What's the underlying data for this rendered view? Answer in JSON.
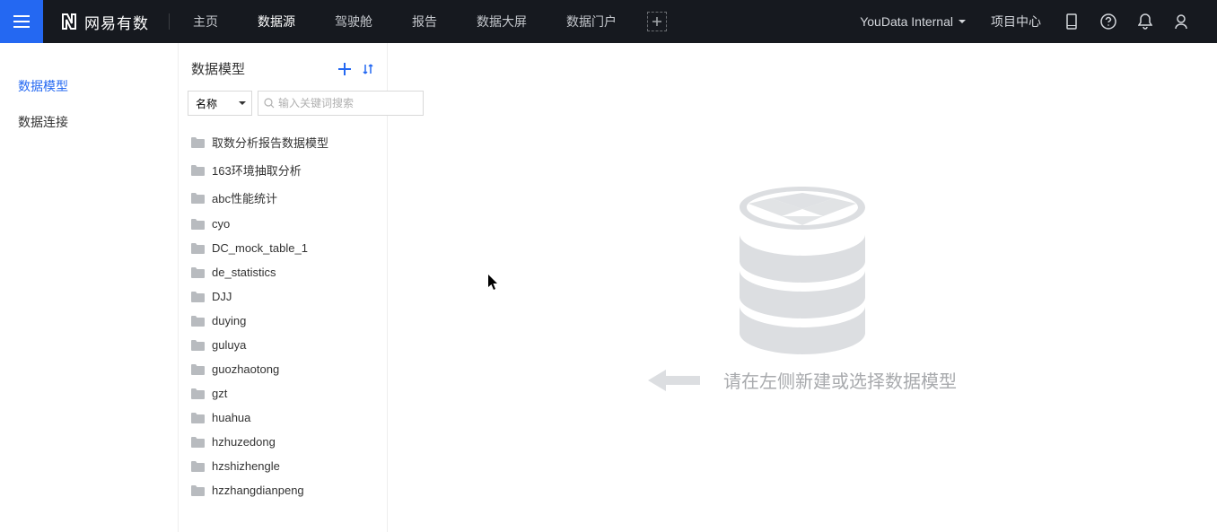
{
  "header": {
    "logo_text": "网易有数",
    "nav": [
      {
        "label": "主页",
        "active": false
      },
      {
        "label": "数据源",
        "active": true
      },
      {
        "label": "驾驶舱",
        "active": false
      },
      {
        "label": "报告",
        "active": false
      },
      {
        "label": "数据大屏",
        "active": false
      },
      {
        "label": "数据门户",
        "active": false
      }
    ],
    "project_name": "YouData Internal",
    "project_center": "项目中心"
  },
  "leftnav": [
    {
      "label": "数据模型",
      "active": true
    },
    {
      "label": "数据连接",
      "active": false
    }
  ],
  "panel": {
    "title": "数据模型",
    "select_label": "名称",
    "search_placeholder": "输入关键词搜索",
    "folders": [
      "取数分析报告数据模型",
      "163环境抽取分析",
      "abc性能统计",
      "cyo",
      "DC_mock_table_1",
      "de_statistics",
      "DJJ",
      "duying",
      "guluya",
      "guozhaotong",
      "gzt",
      "huahua",
      "hzhuzedong",
      "hzshizhengle",
      "hzzhangdianpeng"
    ]
  },
  "empty_text": "请在左侧新建或选择数据模型"
}
